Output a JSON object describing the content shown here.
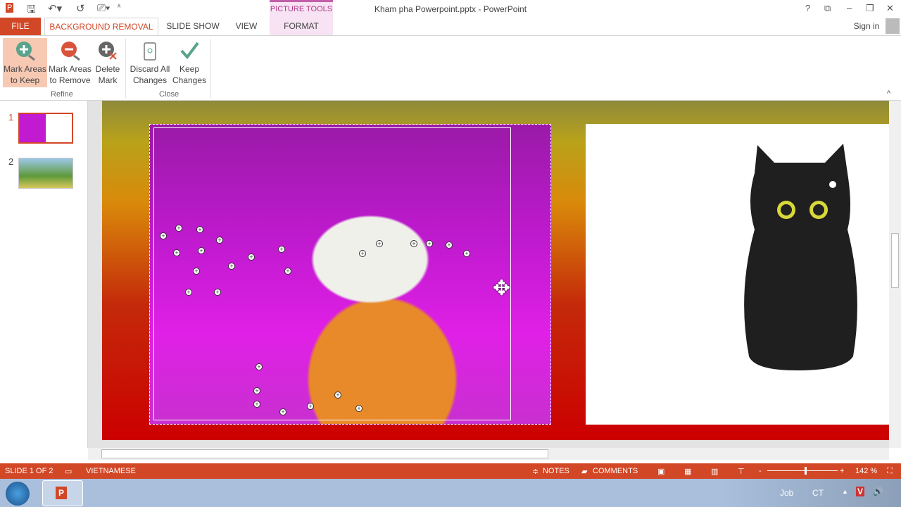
{
  "titlebar": {
    "title": "Kham pha Powerpoint.pptx - PowerPoint",
    "help": "?",
    "restore": "⧉",
    "minimize": "–",
    "maximize": "❐",
    "close": "✕",
    "sign_in": "Sign in",
    "contextual_group": "PICTURE TOOLS"
  },
  "quick_access": {
    "app_icon": "powerpoint-icon",
    "save": "save-icon",
    "undo": "undo-icon",
    "redo": "redo-icon",
    "presentation": "start-from-beginning-icon",
    "customize": "customize-icon"
  },
  "tabs": [
    {
      "label": "FILE"
    },
    {
      "label": "BACKGROUND REMOVAL",
      "active": true
    },
    {
      "label": "SLIDE SHOW"
    },
    {
      "label": "VIEW"
    },
    {
      "label": "FORMAT"
    }
  ],
  "ribbon": {
    "refine": {
      "label": "Refine",
      "buttons": [
        {
          "line1": "Mark Areas",
          "line2": "to Keep",
          "active": true
        },
        {
          "line1": "Mark Areas",
          "line2": "to Remove"
        },
        {
          "line1": "Delete",
          "line2": "Mark"
        }
      ]
    },
    "close": {
      "label": "Close",
      "buttons": [
        {
          "line1": "Discard All",
          "line2": "Changes"
        },
        {
          "line1": "Keep",
          "line2": "Changes"
        }
      ]
    }
  },
  "slides": [
    {
      "number": "1",
      "selected": true
    },
    {
      "number": "2"
    }
  ],
  "status": {
    "slide": "SLIDE 1 OF 2",
    "language": "VIETNAMESE",
    "notes": "NOTES",
    "comments": "COMMENTS",
    "zoom": "142 %",
    "zoom_minus": "-",
    "zoom_plus": "+"
  },
  "taskbar": {
    "job": "Job",
    "ct": "CT"
  },
  "colors": {
    "accent": "#d24726",
    "context": "#c25fa8"
  }
}
